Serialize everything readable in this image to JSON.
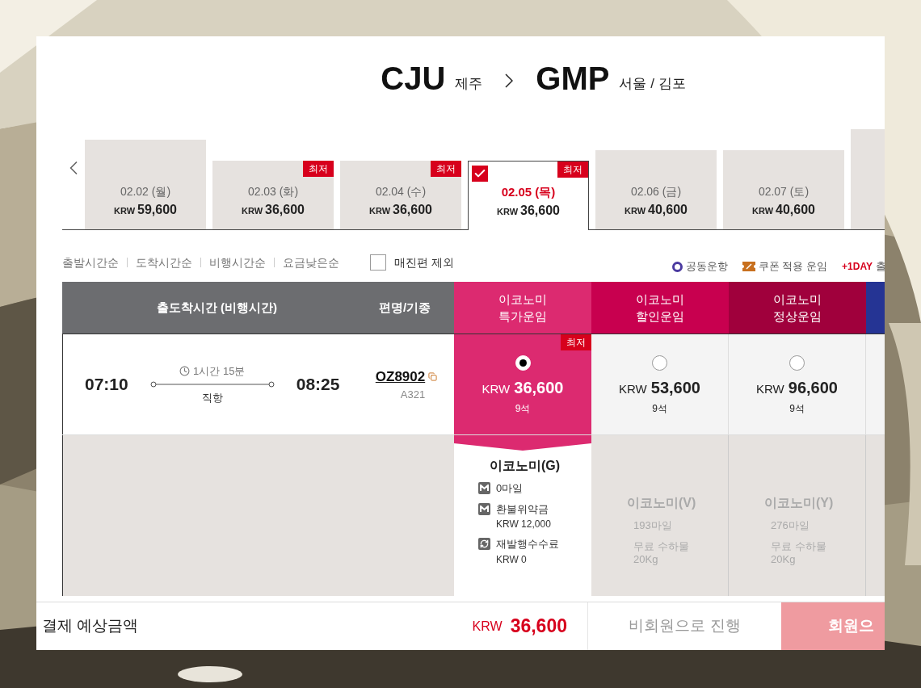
{
  "route": {
    "origin": {
      "code": "CJU",
      "city": "제주"
    },
    "destination": {
      "code": "GMP",
      "city": "서울 / 김포"
    }
  },
  "date_tabs": [
    {
      "date": "02.02 (월)",
      "currency": "KRW",
      "price": "59,600",
      "selected": false
    },
    {
      "date": "02.03 (화)",
      "currency": "KRW",
      "price": "36,600",
      "badge": "최저",
      "selected": false
    },
    {
      "date": "02.04 (수)",
      "currency": "KRW",
      "price": "36,600",
      "badge": "최저",
      "selected": false
    },
    {
      "date": "02.05 (목)",
      "currency": "KRW",
      "price": "36,600",
      "badge": "최저",
      "selected": true
    },
    {
      "date": "02.06 (금)",
      "currency": "KRW",
      "price": "40,600",
      "selected": false
    },
    {
      "date": "02.07 (토)",
      "currency": "KRW",
      "price": "40,600",
      "selected": false
    },
    {
      "selected": false
    }
  ],
  "sort_options": [
    "출발시간순",
    "도착시간순",
    "비행시간순",
    "요금낮은순"
  ],
  "exclude_sold_out": {
    "label": "매진편 제외",
    "checked": false
  },
  "legend": [
    {
      "kind": "codeshare",
      "label": "공동운항"
    },
    {
      "kind": "coupon",
      "label": "쿠폰 적용 운임"
    },
    {
      "kind": "next_day",
      "tag": "+1DAY",
      "label": "출"
    }
  ],
  "table": {
    "columns": [
      {
        "kind": "time",
        "label": "출도착시간 (비행시간)"
      },
      {
        "kind": "flight",
        "label": "편명/기종"
      },
      {
        "kind": "fare",
        "lines": [
          "이코노미",
          "특가운임"
        ],
        "color": "#dc2a70"
      },
      {
        "kind": "fare",
        "lines": [
          "이코노미",
          "할인운임"
        ],
        "color": "#c8004f"
      },
      {
        "kind": "fare",
        "lines": [
          "이코노미",
          "정상운임"
        ],
        "color": "#a0003c"
      },
      {
        "kind": "fare",
        "color": "#253494"
      }
    ],
    "flights": [
      {
        "departure": "07:10",
        "duration": "1시간 15분",
        "stops": "직항",
        "arrival": "08:25",
        "flight_no": "OZ8902",
        "aircraft": "A321",
        "fares": [
          {
            "currency": "KRW",
            "price": "36,600",
            "seats": "9석",
            "badge": "최저",
            "selected": true,
            "class": "이코노미(G)",
            "items": [
              {
                "kind": "mile",
                "label": "0마일"
              },
              {
                "kind": "mile",
                "label": "환불위약금",
                "sub": "KRW 12,000"
              },
              {
                "kind": "reissue",
                "label": "재발행수수료",
                "sub": "KRW 0"
              }
            ]
          },
          {
            "currency": "KRW",
            "price": "53,600",
            "seats": "9석",
            "selected": false,
            "class": "이코노미(V)",
            "items": [
              {
                "label": "193마일"
              },
              {
                "label": "무료 수하물",
                "sub": "20Kg"
              }
            ]
          },
          {
            "currency": "KRW",
            "price": "96,600",
            "seats": "9석",
            "selected": false,
            "class": "이코노미(Y)",
            "items": [
              {
                "label": "276마일"
              },
              {
                "label": "무료 수하물",
                "sub": "20Kg"
              }
            ]
          }
        ]
      }
    ]
  },
  "footer": {
    "label": "결제 예상금액",
    "currency": "KRW",
    "total": "36,600",
    "guest_button": "비회원으로 진행",
    "member_button": "회원으"
  }
}
